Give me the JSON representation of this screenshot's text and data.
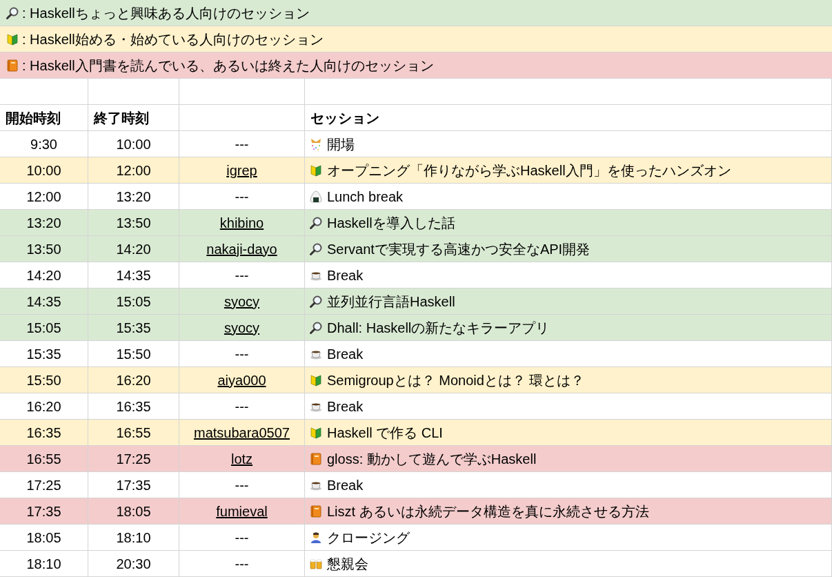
{
  "legend": [
    {
      "kind": "intro",
      "text": ": Haskellちょっと興味ある人向けのセッション"
    },
    {
      "kind": "beginner",
      "text": ": Haskell始める・始めている人向けのセッション"
    },
    {
      "kind": "advanced",
      "text": ": Haskell入門書を読んでいる、あるいは終えた人向けのセッション"
    }
  ],
  "table": {
    "columns": [
      "開始時刻",
      "終了時刻",
      "セッション"
    ],
    "rows": [
      {
        "start": "9:30",
        "end": "10:00",
        "speaker": "---",
        "linked": false,
        "kind": "opening",
        "session": "開場"
      },
      {
        "start": "10:00",
        "end": "12:00",
        "speaker": "igrep",
        "linked": true,
        "kind": "beginner",
        "session": "オープニング「作りながら学ぶHaskell入門」を使ったハンズオン"
      },
      {
        "start": "12:00",
        "end": "13:20",
        "speaker": "---",
        "linked": false,
        "kind": "lunch",
        "session": "Lunch break"
      },
      {
        "start": "13:20",
        "end": "13:50",
        "speaker": "khibino",
        "linked": true,
        "kind": "intro",
        "session": "Haskellを導入した話"
      },
      {
        "start": "13:50",
        "end": "14:20",
        "speaker": "nakaji-dayo",
        "linked": true,
        "kind": "intro",
        "session": "Servantで実現する高速かつ安全なAPI開発"
      },
      {
        "start": "14:20",
        "end": "14:35",
        "speaker": "---",
        "linked": false,
        "kind": "break",
        "session": "Break"
      },
      {
        "start": "14:35",
        "end": "15:05",
        "speaker": "syocy",
        "linked": true,
        "kind": "intro",
        "session": "並列並行言語Haskell"
      },
      {
        "start": "15:05",
        "end": "15:35",
        "speaker": "syocy",
        "linked": true,
        "kind": "intro",
        "session": "Dhall: Haskellの新たなキラーアプリ"
      },
      {
        "start": "15:35",
        "end": "15:50",
        "speaker": "---",
        "linked": false,
        "kind": "break",
        "session": "Break"
      },
      {
        "start": "15:50",
        "end": "16:20",
        "speaker": "aiya000",
        "linked": true,
        "kind": "beginner",
        "session": "Semigroupとは？ Monoidとは？ 環とは？"
      },
      {
        "start": "16:20",
        "end": "16:35",
        "speaker": "---",
        "linked": false,
        "kind": "break",
        "session": "Break"
      },
      {
        "start": "16:35",
        "end": "16:55",
        "speaker": "matsubara0507",
        "linked": true,
        "kind": "beginner",
        "session": "Haskell で作る CLI"
      },
      {
        "start": "16:55",
        "end": "17:25",
        "speaker": "lotz",
        "linked": true,
        "kind": "advanced",
        "session": "gloss: 動かして遊んで学ぶHaskell"
      },
      {
        "start": "17:25",
        "end": "17:35",
        "speaker": "---",
        "linked": false,
        "kind": "break",
        "session": "Break"
      },
      {
        "start": "17:35",
        "end": "18:05",
        "speaker": "fumieval",
        "linked": true,
        "kind": "advanced",
        "session": "Liszt あるいは永続データ構造を真に永続させる方法"
      },
      {
        "start": "18:05",
        "end": "18:10",
        "speaker": "---",
        "linked": false,
        "kind": "closing",
        "session": "クロージング"
      },
      {
        "start": "18:10",
        "end": "20:30",
        "speaker": "---",
        "linked": false,
        "kind": "party",
        "session": "懇親会"
      }
    ]
  }
}
